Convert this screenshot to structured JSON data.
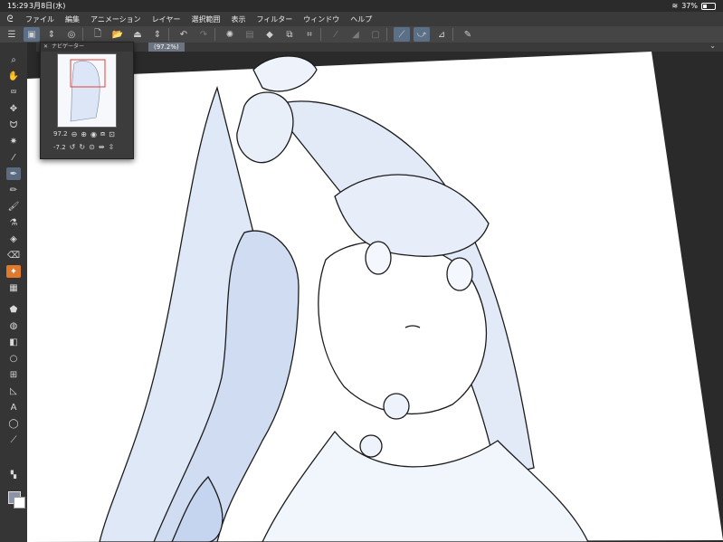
{
  "status": {
    "time": "15:29",
    "date": "3月8日(水)",
    "battery": "37%"
  },
  "menu": [
    "ファイル",
    "編集",
    "アニメーション",
    "レイヤー",
    "選択範囲",
    "表示",
    "フィルター",
    "ウィンドウ",
    "ヘルプ"
  ],
  "tab": {
    "label": "(97.2%)"
  },
  "navigator": {
    "title": "ナビゲーター",
    "zoom": "97.2",
    "rotation": "-7.2"
  },
  "colors": {
    "accent": "#5b6f86",
    "orange": "#e07a2a",
    "line_blue": "#c8d6ef"
  }
}
